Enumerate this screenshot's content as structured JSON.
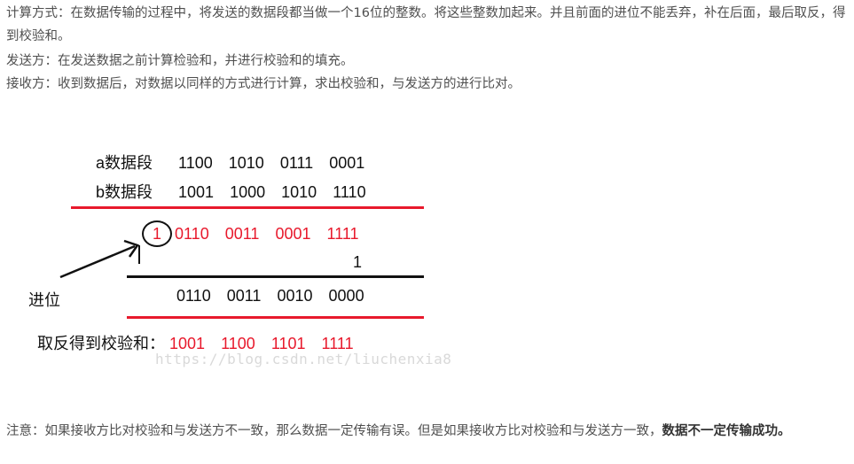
{
  "paragraphs": {
    "p1": "计算方式：在数据传输的过程中，将发送的数据段都当做一个16位的整数。将这些整数加起来。并且前面的进位不能丢弃，补在后面，最后取反，得到校验和。",
    "p2": "发送方：在发送数据之前计算检验和，并进行校验和的填充。",
    "p3": "接收方：收到数据后，对数据以同样的方式进行计算，求出校验和，与发送方的进行比对。"
  },
  "figure": {
    "a_label": "a数据段",
    "a_nibbles": [
      "1100",
      "1010",
      "0111",
      "0001"
    ],
    "b_label": "b数据段",
    "b_nibbles": [
      "1001",
      "1000",
      "1010",
      "1110"
    ],
    "carry_bit": "1",
    "sum_nibbles": [
      "0110",
      "0011",
      "0001",
      "1111"
    ],
    "carry_add": "1",
    "result_nibbles": [
      "0110",
      "0011",
      "0010",
      "0000"
    ],
    "carry_label": "进位",
    "checksum_label": "取反得到校验和：",
    "checksum_nibbles": [
      "1001",
      "1100",
      "1101",
      "1111"
    ],
    "watermark": "https://blog.csdn.net/liuchenxia8"
  },
  "note": {
    "text": "注意：如果接收方比对校验和与发送方不一致，那么数据一定传输有误。但是如果接收方比对校验和与发送方一致，",
    "bold": "数据不一定传输成功。"
  },
  "colors": {
    "accent_red": "#e8192c",
    "text": "#4f4f4f"
  }
}
